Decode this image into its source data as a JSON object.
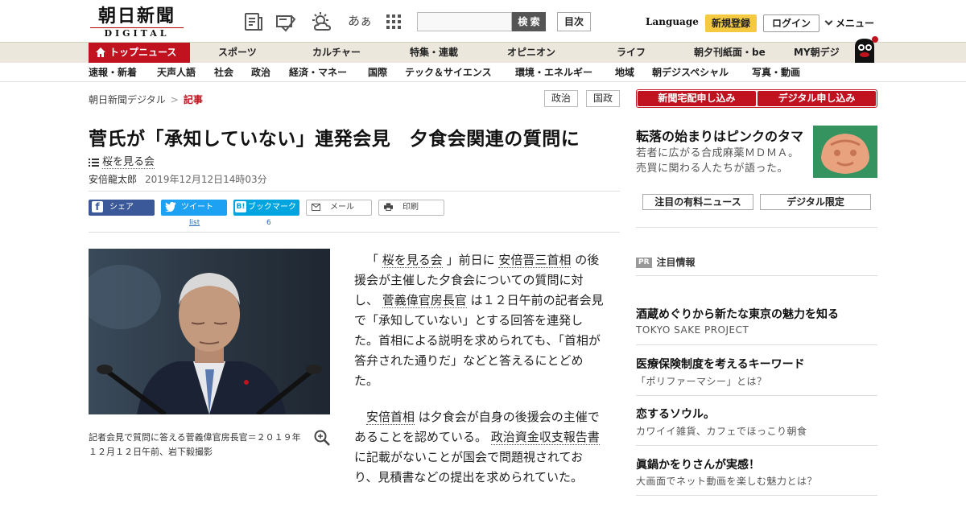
{
  "header": {
    "logo_main": "朝日新聞",
    "logo_sub": "DIGITAL",
    "search_button": "検 索",
    "contents_button": "目次",
    "language_link": "Language",
    "register_button": "新規登録",
    "login_button": "ログイン",
    "menu_button": "メニュー",
    "font_toggle_label": "あぁ"
  },
  "nav": {
    "active": "トップニュース",
    "items": [
      "スポーツ",
      "カルチャー",
      "特集・連載",
      "オピニオン",
      "ライフ",
      "朝夕刊紙面・be",
      "MY朝デジ"
    ]
  },
  "subnav": {
    "items": [
      "速報・新着",
      "天声人語",
      "社会",
      "政治",
      "経済・マネー",
      "国際",
      "テック＆サイエンス",
      "環境・エネルギー",
      "地域",
      "朝デジスペシャル",
      "写真・動画"
    ]
  },
  "breadcrumb": {
    "home": "朝日新聞デジタル",
    "separator": ">",
    "current": "記事"
  },
  "tags": [
    "政治",
    "国政"
  ],
  "article": {
    "headline": "菅氏が「承知していない」連発会見　夕食会関連の質問に",
    "topic": "桜を見る会",
    "author": "安倍龍太郎",
    "date": "2019年12月12日14時03分",
    "caption": "記者会見で質問に答える菅義偉官房長官＝２０１９年１２月１２日午前、岩下毅撮影",
    "p1": {
      "a": "「",
      "l1": "桜を見る会",
      "b": "」前日に",
      "l2": "安倍晋三首相",
      "c": "の後援会が主催した夕食会についての質問に対し、",
      "l3": "菅義偉官房長官",
      "d": "は１２日午前の記者会見で「承知していない」とする回答を連発した。首相による説明を求められても、「首相が答弁された通りだ」などと答えるにとどめた。"
    },
    "p2": {
      "l1": "安倍首相",
      "a": "は夕食会が自身の後援会の主催であることを認めている。",
      "l2": "政治資金収支報告書",
      "b": "に記載がないことが国会で問題視されており、見積書などの提出を求められていた。"
    }
  },
  "share": {
    "facebook": "シェア",
    "twitter": "ツイート",
    "hatena": "ブックマーク",
    "mail": "メール",
    "print": "印刷",
    "twitter_sub": "list",
    "hatena_count": "6"
  },
  "sidebar": {
    "home_delivery_button": "新聞宅配申し込み",
    "digital_button": "デジタル申し込み",
    "promo_title": "転落の始まりはピンクのタマ",
    "promo_sub": "若者に広がる合成麻薬ＭＤＭＡ。売買に関わる人たちが語った。",
    "paid_news_button": "注目の有料ニュース",
    "digital_only_button": "デジタル限定",
    "pr_badge": "PR",
    "pr_heading": "注目情報",
    "pr_items": [
      {
        "title": "酒蔵めぐりから新たな東京の魅力を知る",
        "sub": "TOKYO SAKE PROJECT"
      },
      {
        "title": "医療保険制度を考えるキーワード",
        "sub": "「ポリファーマシー」とは？"
      },
      {
        "title": "恋するソウル。",
        "sub": "カワイイ雑貨、カフェでほっこり朝食"
      },
      {
        "title": "眞鍋かをりさんが実感！",
        "sub": "大画面でネット動画を楽しむ魅力とは？"
      }
    ]
  },
  "colors": {
    "brand_red": "#c1121f",
    "nav_bg": "#ebe7dc",
    "register_yellow": "#f5c940",
    "facebook": "#3b5998",
    "twitter": "#1da1f2",
    "hatena": "#00a4de"
  },
  "icons": [
    "news-icon",
    "hand-note-icon",
    "weather-icon",
    "font-size-icon",
    "grid-menu-icon",
    "home-icon",
    "list-icon",
    "zoom-in-icon",
    "mail-icon",
    "print-icon",
    "facebook-icon",
    "twitter-icon",
    "hatena-icon",
    "mascot-icon"
  ]
}
